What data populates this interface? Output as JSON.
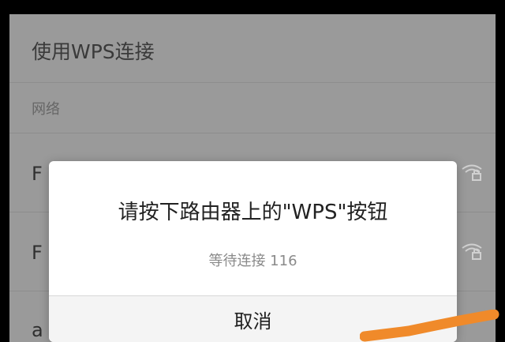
{
  "header": {
    "title": "使用WPS连接"
  },
  "section": {
    "label": "网络"
  },
  "networks": [
    {
      "name": "F"
    },
    {
      "name": "F"
    },
    {
      "name": "a"
    }
  ],
  "dialog": {
    "title": "请按下路由器上的\"WPS\"按钮",
    "status": "等待连接 116",
    "cancel_label": "取消"
  },
  "icons": {
    "wifi_locked": "wifi-lock-icon"
  },
  "colors": {
    "overlay_bg": "#9a9a9a",
    "dialog_bg": "#ffffff",
    "annotation": "#f08a2a"
  }
}
